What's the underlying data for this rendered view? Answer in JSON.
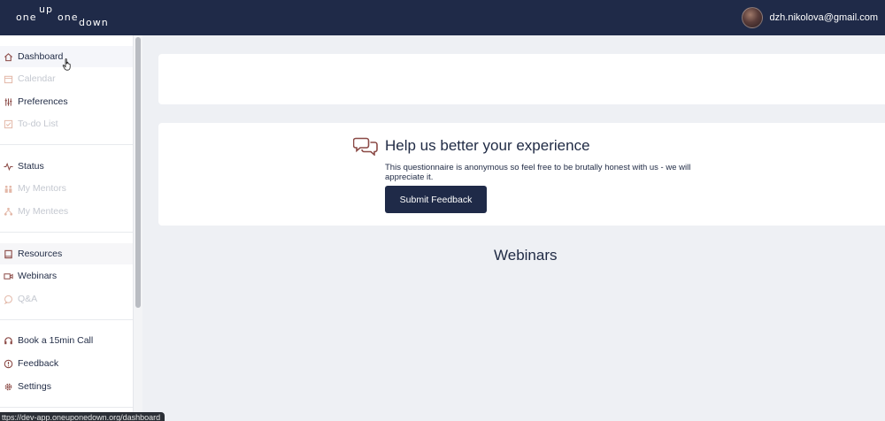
{
  "header": {
    "logo_words": [
      "one",
      "up",
      "one",
      "down"
    ],
    "user_email": "dzh.nikolova@gmail.com"
  },
  "sidebar": {
    "items": [
      {
        "label": "Dashboard",
        "icon": "home-icon"
      },
      {
        "label": "Calendar",
        "icon": "calendar-icon"
      },
      {
        "label": "Preferences",
        "icon": "sliders-icon"
      },
      {
        "label": "To-do List",
        "icon": "checkbox-icon"
      },
      {
        "label": "Status",
        "icon": "pulse-icon"
      },
      {
        "label": "My Mentors",
        "icon": "people-icon"
      },
      {
        "label": "My Mentees",
        "icon": "hierarchy-icon"
      },
      {
        "label": "Resources",
        "icon": "book-icon"
      },
      {
        "label": "Webinars",
        "icon": "video-icon"
      },
      {
        "label": "Q&A",
        "icon": "chat-bubble-icon"
      },
      {
        "label": "Book a 15min Call",
        "icon": "headset-icon"
      },
      {
        "label": "Feedback",
        "icon": "alert-icon"
      },
      {
        "label": "Settings",
        "icon": "gear-icon"
      }
    ]
  },
  "feedback_card": {
    "icon": "chat-bubbles-icon",
    "title": "Help us better your experience",
    "text": "This questionnaire is anonymous so feel free to be brutally honest with us - we will appreciate it.",
    "button_label": "Submit Feedback"
  },
  "webinars": {
    "title": "Webinars"
  },
  "status_bar": {
    "url": "ttps://dev-app.oneuponedown.org/dashboard"
  },
  "colors": {
    "navy": "#1f2a48",
    "accent_icon": "#8b4a46",
    "background": "#eef0f4",
    "disabled_text": "#c4c8d0"
  }
}
